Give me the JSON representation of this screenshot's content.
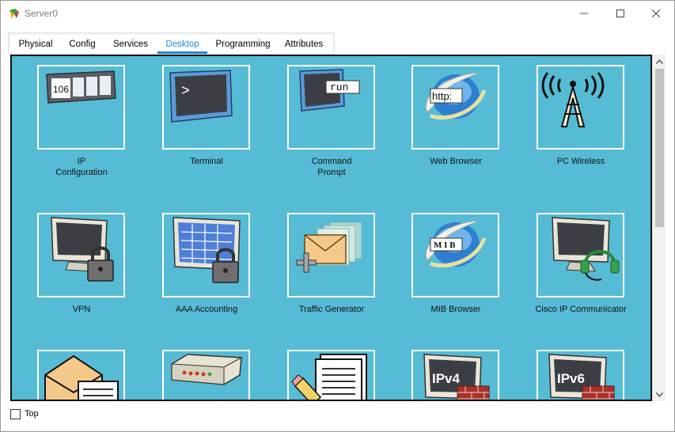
{
  "window": {
    "title": "Server0"
  },
  "tabs": [
    {
      "label": "Physical",
      "active": false
    },
    {
      "label": "Config",
      "active": false
    },
    {
      "label": "Services",
      "active": false
    },
    {
      "label": "Desktop",
      "active": true
    },
    {
      "label": "Programming",
      "active": false
    },
    {
      "label": "Attributes",
      "active": false
    }
  ],
  "apps": [
    {
      "label": "IP\nConfiguration",
      "icon": "ip-configuration-icon"
    },
    {
      "label": "Terminal",
      "icon": "terminal-icon"
    },
    {
      "label": "Command\nPrompt",
      "icon": "command-prompt-icon"
    },
    {
      "label": "Web Browser",
      "icon": "web-browser-icon"
    },
    {
      "label": "PC Wireless",
      "icon": "pc-wireless-icon"
    },
    {
      "label": "VPN",
      "icon": "vpn-icon"
    },
    {
      "label": "AAA Accounting",
      "icon": "aaa-accounting-icon"
    },
    {
      "label": "Traffic Generator",
      "icon": "traffic-generator-icon"
    },
    {
      "label": "MIB Browser",
      "icon": "mib-browser-icon"
    },
    {
      "label": "Cisco IP Communicator",
      "icon": "cisco-ip-communicator-icon"
    },
    {
      "label": "",
      "icon": "email-icon"
    },
    {
      "label": "",
      "icon": "pppoe-dialer-icon"
    },
    {
      "label": "",
      "icon": "text-editor-icon"
    },
    {
      "label": "",
      "icon": "ipv4-firewall-icon"
    },
    {
      "label": "",
      "icon": "ipv6-firewall-icon"
    }
  ],
  "icon_text": {
    "ip_config": "106",
    "terminal": ">",
    "cmd": "run",
    "browser": "http:",
    "mib": "M I B",
    "ipv4": "IPv4",
    "ipv6": "IPv6"
  },
  "footer": {
    "top_label": "Top",
    "top_checked": false
  },
  "colors": {
    "desktop_bg": "#56bbd5",
    "tab_active": "#1e88d0"
  }
}
